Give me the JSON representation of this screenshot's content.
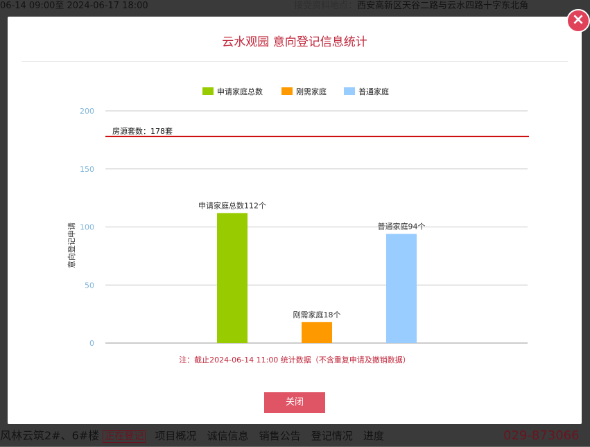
{
  "background": {
    "top_left": "06-14 09:00至 2024-06-17 18:00",
    "top_right_label": "接受资料地点：",
    "top_right_value": "西安高新区天谷二路与云水四路十字东北角",
    "bottom_project": "风林云筑2#、6#楼",
    "bottom_status": "正在登记",
    "bottom_links": [
      "项目概况",
      "诚信信息",
      "销售公告",
      "登记情况",
      "进度"
    ],
    "bottom_phone": "029-873066"
  },
  "modal": {
    "title": "云水观园 意向登记信息统计",
    "note": "注：截止2024-06-14 11:00 统计数据（不含重复申请及撤销数据）",
    "close_button": "关闭",
    "close_icon": "×"
  },
  "chart_data": {
    "type": "bar",
    "categories": [
      "申请家庭总数",
      "刚需家庭",
      "普通家庭"
    ],
    "values": [
      112,
      18,
      94
    ],
    "colors": [
      "#99cc00",
      "#ff9900",
      "#99ccff"
    ],
    "legend": [
      "申请家庭总数",
      "刚需家庭",
      "普通家庭"
    ],
    "legend_position": "top",
    "data_labels": [
      "申请家庭总数112个",
      "刚需家庭18个",
      "普通家庭94个"
    ],
    "ylabel": "意向登记申请",
    "ylim": [
      0,
      200
    ],
    "yticks": [
      0,
      50,
      100,
      150,
      200
    ],
    "reference_line": {
      "value": 178,
      "label": "房源套数：178套",
      "color": "#cc0000"
    },
    "grid": true
  }
}
